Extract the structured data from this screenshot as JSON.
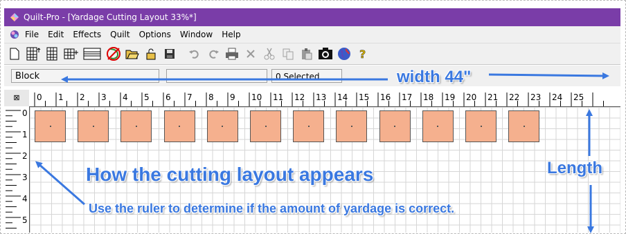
{
  "window": {
    "title": "Quilt-Pro - [Yardage Cutting Layout 33%*]",
    "title_bar_color": "#7a3da8"
  },
  "menu": {
    "items": [
      "File",
      "Edit",
      "Effects",
      "Quilt",
      "Options",
      "Window",
      "Help"
    ]
  },
  "toolbar": {
    "icons": [
      "new-file-icon",
      "block-grid-icon",
      "grid-icon",
      "grid-add-icon",
      "border-icon",
      "no-symbol-icon",
      "open-folder-icon",
      "unlock-icon",
      "save-icon",
      "undo-icon",
      "redo-icon",
      "print-icon",
      "cut-x-icon",
      "scissors-icon",
      "copy-icon",
      "paste-icon",
      "camera-icon",
      "globe-icon",
      "help-icon"
    ]
  },
  "status": {
    "mode": "Block",
    "middle": "",
    "selected": "0 Selected"
  },
  "ruler": {
    "corner_symbol": "⊠",
    "top_labels": [
      "0",
      "1",
      "2",
      "3",
      "4",
      "5",
      "6",
      "7",
      "8",
      "9",
      "10",
      "11",
      "12",
      "13",
      "14",
      "15",
      "16",
      "17",
      "18",
      "19",
      "20",
      "21",
      "22",
      "23",
      "24",
      "25"
    ],
    "left_labels": [
      "0",
      "1",
      "2",
      "3",
      "4",
      "5"
    ]
  },
  "layout": {
    "block_count": 12,
    "block_color": "#f5b08e"
  },
  "annotations": {
    "width": "width 44\"",
    "length": "Length",
    "how": "How the cutting layout appears",
    "ruler_hint": "Use the ruler to determine if the amount of yardage is correct.",
    "color": "#3a78e0"
  }
}
